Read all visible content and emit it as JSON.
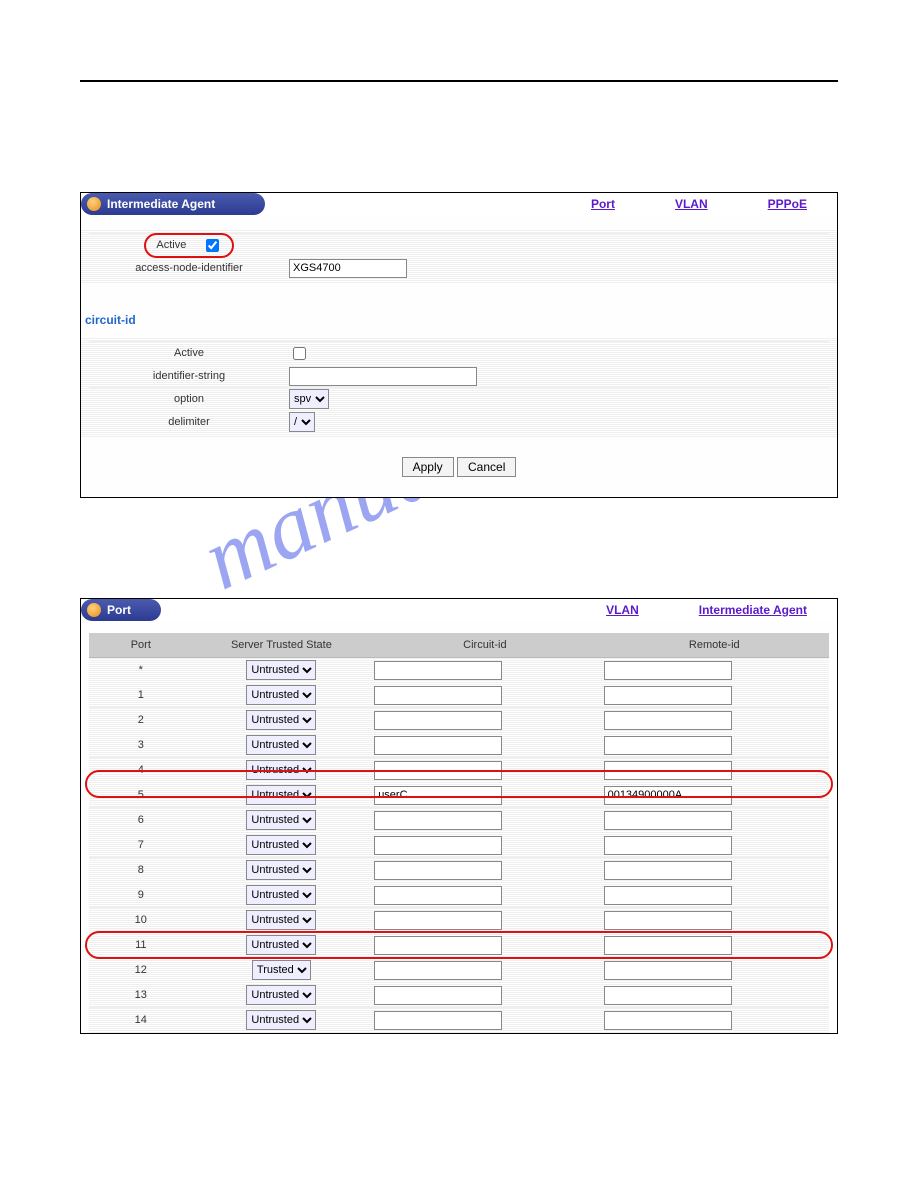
{
  "watermark": "manualshive.com",
  "panel1": {
    "title": "Intermediate Agent",
    "links": {
      "port": "Port",
      "vlan": "VLAN",
      "pppoe": "PPPoE"
    },
    "active_label": "Active",
    "active_checked": true,
    "ani_label": "access-node-identifier",
    "ani_value": "XGS4700",
    "section": "circuit-id",
    "cid_active_label": "Active",
    "cid_active_checked": false,
    "idstr_label": "identifier-string",
    "idstr_value": "",
    "option_label": "option",
    "option_value": "spv",
    "delim_label": "delimiter",
    "delim_value": "/",
    "btn_apply": "Apply",
    "btn_cancel": "Cancel"
  },
  "panel2": {
    "title": "Port",
    "links": {
      "vlan": "VLAN",
      "ia": "Intermediate Agent"
    },
    "headers": {
      "port": "Port",
      "sts": "Server Trusted State",
      "cid": "Circuit-id",
      "rid": "Remote-id"
    },
    "rows": [
      {
        "port": "*",
        "state": "Untrusted",
        "cid": "",
        "rid": ""
      },
      {
        "port": "1",
        "state": "Untrusted",
        "cid": "",
        "rid": ""
      },
      {
        "port": "2",
        "state": "Untrusted",
        "cid": "",
        "rid": ""
      },
      {
        "port": "3",
        "state": "Untrusted",
        "cid": "",
        "rid": ""
      },
      {
        "port": "4",
        "state": "Untrusted",
        "cid": "",
        "rid": ""
      },
      {
        "port": "5",
        "state": "Untrusted",
        "cid": "userC",
        "rid": "00134900000A"
      },
      {
        "port": "6",
        "state": "Untrusted",
        "cid": "",
        "rid": ""
      },
      {
        "port": "7",
        "state": "Untrusted",
        "cid": "",
        "rid": ""
      },
      {
        "port": "8",
        "state": "Untrusted",
        "cid": "",
        "rid": ""
      },
      {
        "port": "9",
        "state": "Untrusted",
        "cid": "",
        "rid": ""
      },
      {
        "port": "10",
        "state": "Untrusted",
        "cid": "",
        "rid": ""
      },
      {
        "port": "11",
        "state": "Untrusted",
        "cid": "",
        "rid": ""
      },
      {
        "port": "12",
        "state": "Trusted",
        "cid": "",
        "rid": ""
      },
      {
        "port": "13",
        "state": "Untrusted",
        "cid": "",
        "rid": ""
      },
      {
        "port": "14",
        "state": "Untrusted",
        "cid": "",
        "rid": ""
      }
    ]
  }
}
